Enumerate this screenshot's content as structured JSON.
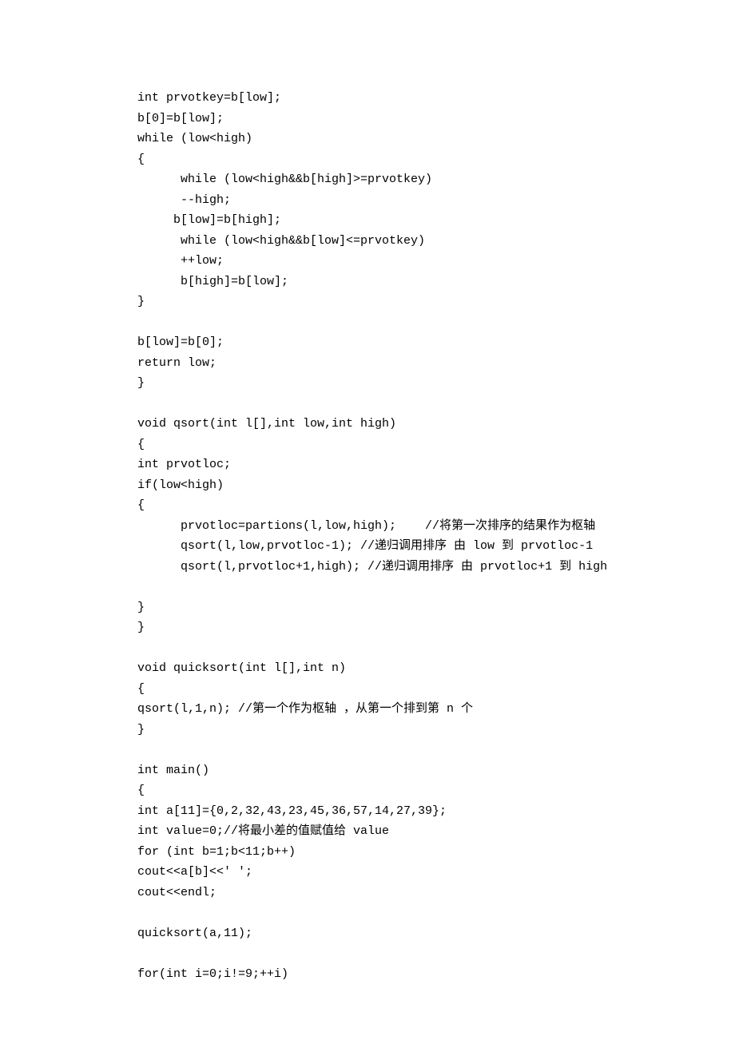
{
  "code_lines": [
    "int prvotkey=b[low];",
    "b[0]=b[low];",
    "while (low<high)",
    "{",
    "      while (low<high&&b[high]>=prvotkey)",
    "      --high;",
    "     b[low]=b[high];",
    "      while (low<high&&b[low]<=prvotkey)",
    "      ++low;",
    "      b[high]=b[low];",
    "}",
    "",
    "b[low]=b[0];",
    "return low;",
    "}",
    "",
    "void qsort(int l[],int low,int high)",
    "{",
    "int prvotloc;",
    "if(low<high)",
    "{",
    "      prvotloc=partions(l,low,high);    //将第一次排序的结果作为枢轴",
    "      qsort(l,low,prvotloc-1); //递归调用排序 由 low 到 prvotloc-1",
    "      qsort(l,prvotloc+1,high); //递归调用排序 由 prvotloc+1 到 high",
    "",
    "}",
    "}",
    "",
    "void quicksort(int l[],int n)",
    "{",
    "qsort(l,1,n); //第一个作为枢轴 ，从第一个排到第 n 个",
    "}",
    "",
    "int main()",
    "{",
    "int a[11]={0,2,32,43,23,45,36,57,14,27,39};",
    "int value=0;//将最小差的值赋值给 value",
    "for (int b=1;b<11;b++)",
    "cout<<a[b]<<' ';",
    "cout<<endl;",
    "",
    "quicksort(a,11);",
    "",
    "for(int i=0;i!=9;++i)"
  ]
}
